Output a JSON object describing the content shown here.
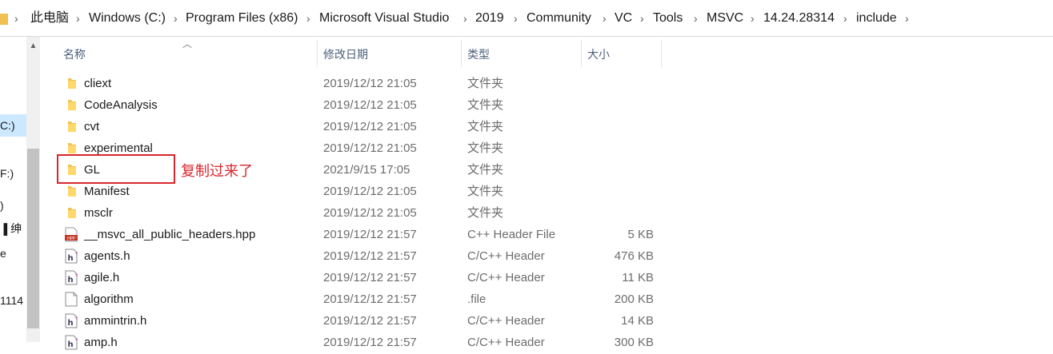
{
  "breadcrumb": [
    "此电脑",
    "Windows (C:)",
    "Program Files (x86)",
    "Microsoft Visual Studio",
    "2019",
    "Community",
    "VC",
    "Tools",
    "MSVC",
    "14.24.28314",
    "include"
  ],
  "nav_fragments": [
    "C:)",
    "F:)",
    ")",
    "绅",
    "e",
    "1114"
  ],
  "columns": {
    "name": "名称",
    "date": "修改日期",
    "type": "类型",
    "size": "大小"
  },
  "files": [
    {
      "icon": "folder-icon",
      "name": "cliext",
      "date": "2019/12/12 21:05",
      "type": "文件夹",
      "size": ""
    },
    {
      "icon": "folder-icon",
      "name": "CodeAnalysis",
      "date": "2019/12/12 21:05",
      "type": "文件夹",
      "size": ""
    },
    {
      "icon": "folder-icon",
      "name": "cvt",
      "date": "2019/12/12 21:05",
      "type": "文件夹",
      "size": ""
    },
    {
      "icon": "folder-icon",
      "name": "experimental",
      "date": "2019/12/12 21:05",
      "type": "文件夹",
      "size": ""
    },
    {
      "icon": "folder-icon",
      "name": "GL",
      "date": "2021/9/15 17:05",
      "type": "文件夹",
      "size": ""
    },
    {
      "icon": "folder-icon",
      "name": "Manifest",
      "date": "2019/12/12 21:05",
      "type": "文件夹",
      "size": ""
    },
    {
      "icon": "folder-icon",
      "name": "msclr",
      "date": "2019/12/12 21:05",
      "type": "文件夹",
      "size": ""
    },
    {
      "icon": "hpp-file-icon",
      "name": "__msvc_all_public_headers.hpp",
      "date": "2019/12/12 21:57",
      "type": "C++ Header File",
      "size": "5 KB"
    },
    {
      "icon": "h-file-icon",
      "name": "agents.h",
      "date": "2019/12/12 21:57",
      "type": "C/C++ Header",
      "size": "476 KB"
    },
    {
      "icon": "h-file-icon",
      "name": "agile.h",
      "date": "2019/12/12 21:57",
      "type": "C/C++ Header",
      "size": "11 KB"
    },
    {
      "icon": "blank-file-icon",
      "name": "algorithm",
      "date": "2019/12/12 21:57",
      "type": ".file",
      "size": "200 KB"
    },
    {
      "icon": "h-file-icon",
      "name": "ammintrin.h",
      "date": "2019/12/12 21:57",
      "type": "C/C++ Header",
      "size": "14 KB"
    },
    {
      "icon": "h-file-icon",
      "name": "amp.h",
      "date": "2019/12/12 21:57",
      "type": "C/C++ Header",
      "size": "300 KB"
    }
  ],
  "annotation": {
    "text": "复制过来了",
    "color": "#d8262c"
  },
  "colors": {
    "folder": "#f0c050",
    "selection": "#cce8ff",
    "header_text": "#4c607a"
  }
}
